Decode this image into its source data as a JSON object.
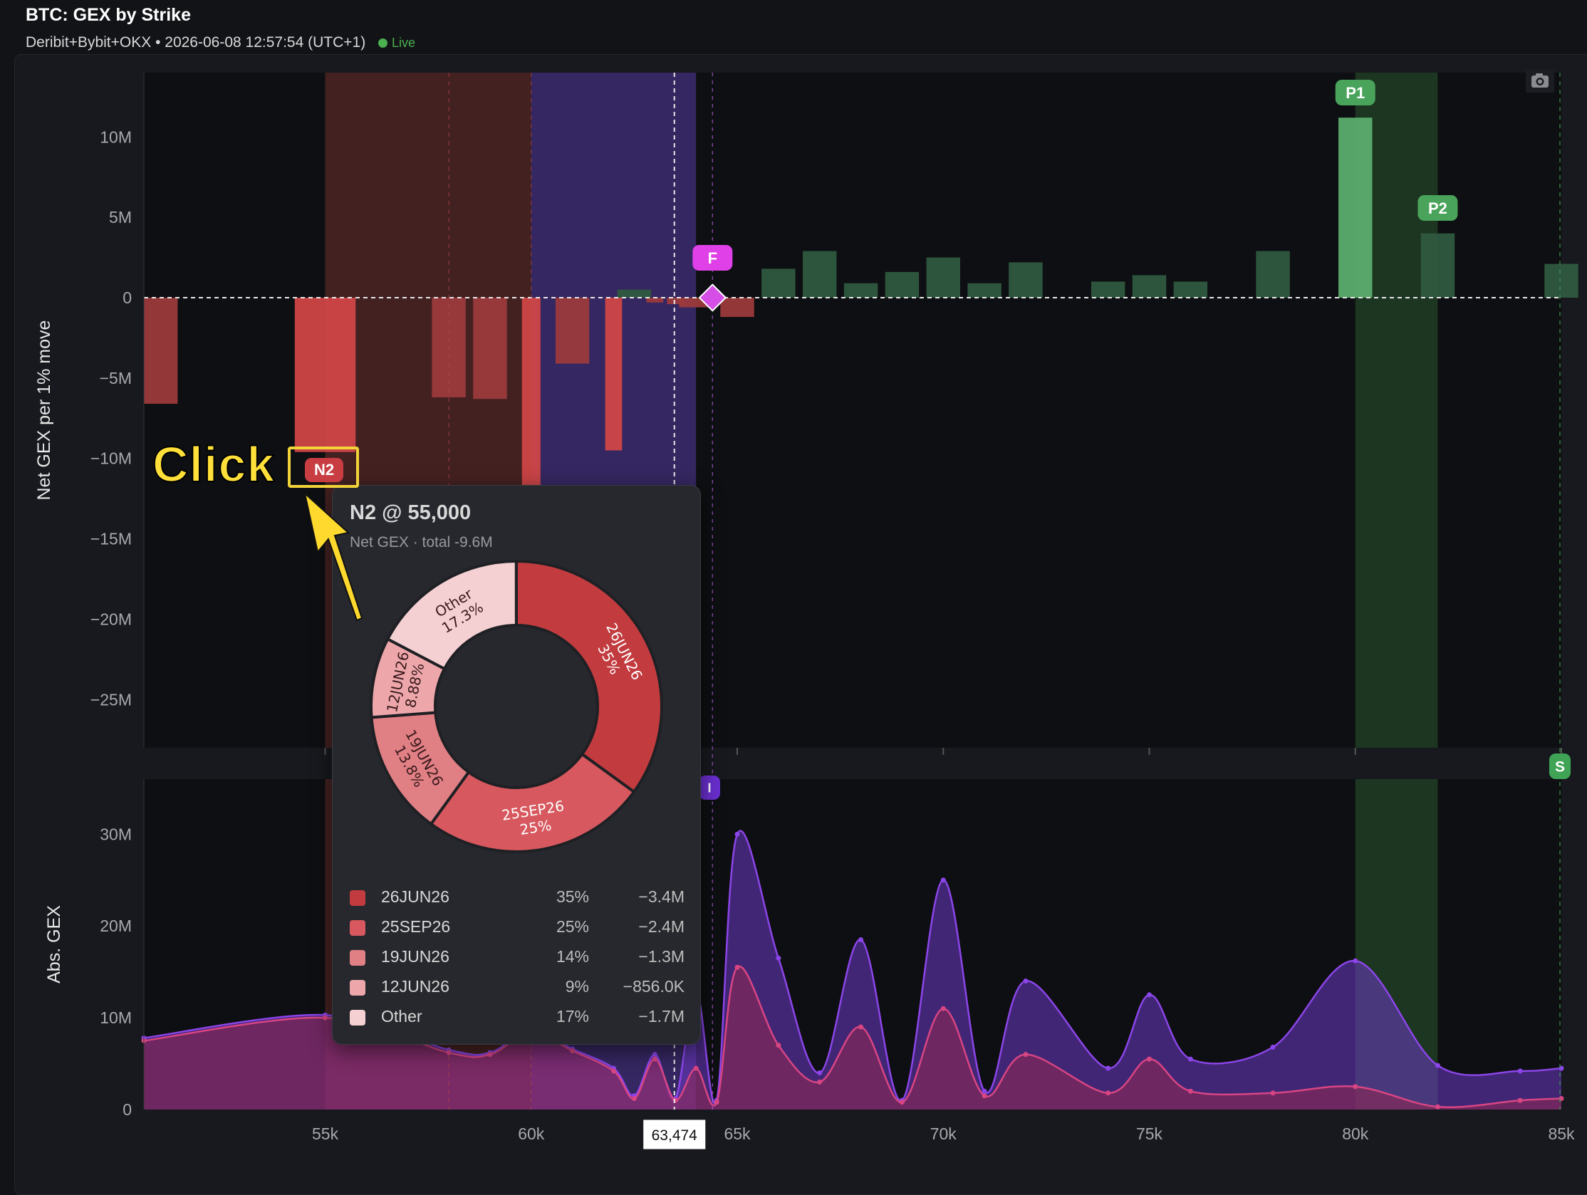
{
  "header": {
    "title": "BTC: GEX by Strike",
    "subtitle": "Deribit+Bybit+OKX • 2026-06-08 12:57:54 (UTC+1)",
    "status": "Live"
  },
  "colors": {
    "background": "#121317",
    "positive_bar": "#2f5a40",
    "positive_highlight": "#5cad6e",
    "negative_bar": "#9c3a3c",
    "negative_highlight": "#d04647",
    "purple_zone": "#3a2a6a",
    "red_zone": "#4a2424",
    "green_zone": "#1f3b24",
    "abs_total_line": "#8b45e8",
    "abs_net_line": "#d84583",
    "flip_marker": "#e040e8"
  },
  "markers": {
    "p1": "P1",
    "p2": "P2",
    "flip": "F",
    "spot": "S",
    "cursor_price": "63,474",
    "n2": "N2",
    "partial": "I"
  },
  "annotation": {
    "click": "Click"
  },
  "tooltip": {
    "title": "N2 @ 55,000",
    "subtitle": "Net GEX · total -9.6M",
    "slices": [
      {
        "name": "26JUN26",
        "pct_label": "35%",
        "legend_pct": "35%",
        "value": "−3.4M",
        "fraction": 0.35,
        "color": "#c23b3f",
        "label_color": "#ffffff"
      },
      {
        "name": "25SEP26",
        "pct_label": "25%",
        "legend_pct": "25%",
        "value": "−2.4M",
        "fraction": 0.25,
        "color": "#d7585e",
        "label_color": "#ffffff"
      },
      {
        "name": "19JUN26",
        "pct_label": "13.8%",
        "legend_pct": "14%",
        "value": "−1.3M",
        "fraction": 0.138,
        "color": "#e07f84",
        "label_color": "#3a1a1c"
      },
      {
        "name": "12JUN26",
        "pct_label": "8.88%",
        "legend_pct": "9%",
        "value": "−856.0K",
        "fraction": 0.0888,
        "color": "#eda7ab",
        "label_color": "#3a1a1c"
      },
      {
        "name": "Other",
        "pct_label": "17.3%",
        "legend_pct": "17%",
        "value": "−1.7M",
        "fraction": 0.173,
        "color": "#f5d0d2",
        "label_color": "#3a1a1c"
      }
    ]
  },
  "chart_data": [
    {
      "type": "bar",
      "ylabel": "Net GEX per 1% move",
      "xlabel": "",
      "ylim": [
        -28,
        14
      ],
      "y_ticks": [
        10,
        5,
        0,
        -5,
        -10,
        -15,
        -20,
        -25
      ],
      "y_tick_labels": [
        "10M",
        "5M",
        "0",
        "−5M",
        "−10M",
        "−15M",
        "−20M",
        "−25M"
      ],
      "y_units": "M",
      "xlim": [
        50600,
        85000
      ],
      "x_ticks": [
        55000,
        60000,
        65000,
        70000,
        75000,
        80000,
        85000
      ],
      "x_tick_labels": [
        "55k",
        "60k",
        "65k",
        "70k",
        "75k",
        "80k",
        "85k"
      ],
      "grid": false,
      "cursor_x": 63474,
      "flip_strike": 64400,
      "bars": [
        {
          "strike": 51000,
          "value": -6.6
        },
        {
          "strike": 55000,
          "value": -9.6,
          "highlight": true,
          "label": "N2"
        },
        {
          "strike": 58000,
          "value": -6.2
        },
        {
          "strike": 59000,
          "value": -6.3
        },
        {
          "strike": 60000,
          "value": -11.8,
          "highlight": true
        },
        {
          "strike": 61000,
          "value": -4.1
        },
        {
          "strike": 62000,
          "value": -9.5,
          "highlight": true
        },
        {
          "strike": 62500,
          "value": 0.5
        },
        {
          "strike": 63000,
          "value": -0.3
        },
        {
          "strike": 63500,
          "value": -0.4
        },
        {
          "strike": 64000,
          "value": -0.6
        },
        {
          "strike": 65000,
          "value": -1.2
        },
        {
          "strike": 66000,
          "value": 1.8
        },
        {
          "strike": 67000,
          "value": 2.9
        },
        {
          "strike": 68000,
          "value": 0.9
        },
        {
          "strike": 69000,
          "value": 1.6
        },
        {
          "strike": 70000,
          "value": 2.5
        },
        {
          "strike": 71000,
          "value": 0.9
        },
        {
          "strike": 72000,
          "value": 2.2
        },
        {
          "strike": 74000,
          "value": 1.0
        },
        {
          "strike": 75000,
          "value": 1.4
        },
        {
          "strike": 76000,
          "value": 1.0
        },
        {
          "strike": 78000,
          "value": 2.9
        },
        {
          "strike": 80000,
          "value": 11.2,
          "highlight": true,
          "label": "P1"
        },
        {
          "strike": 82000,
          "value": 4.0,
          "label": "P2"
        },
        {
          "strike": 85000,
          "value": 2.1
        }
      ],
      "zones": [
        {
          "from": 55000,
          "to": 60000,
          "kind": "red"
        },
        {
          "from": 60000,
          "to": 64000,
          "kind": "purple"
        },
        {
          "from": 80000,
          "to": 82000,
          "kind": "green"
        }
      ]
    },
    {
      "type": "area",
      "ylabel": "Abs. GEX",
      "xlabel": "",
      "ylim": [
        0,
        36
      ],
      "y_ticks": [
        0,
        10,
        20,
        30
      ],
      "y_tick_labels": [
        "0",
        "10M",
        "20M",
        "30M"
      ],
      "y_units": "M",
      "xlim": [
        50600,
        85000
      ],
      "x_ticks": [
        55000,
        60000,
        65000,
        70000,
        75000,
        80000,
        85000
      ],
      "x_tick_labels": [
        "55k",
        "60k",
        "65k",
        "70k",
        "75k",
        "80k",
        "85k"
      ],
      "grid": false,
      "series": [
        {
          "x": [
            50600,
            55000,
            58000,
            59000,
            60000,
            61000,
            62000,
            62500,
            63000,
            63500,
            64000,
            64500,
            65000,
            66000,
            67000,
            68000,
            69000,
            70000,
            71000,
            72000,
            74000,
            75000,
            76000,
            78000,
            80000,
            82000,
            84000,
            85000
          ],
          "y": [
            7.8,
            10.3,
            6.5,
            6.2,
            8.7,
            6.6,
            4.5,
            1.5,
            6.0,
            1.2,
            13.0,
            1.0,
            30.0,
            16.5,
            4.0,
            18.5,
            1.0,
            25.0,
            2.0,
            14.0,
            4.5,
            12.5,
            5.5,
            6.8,
            16.2,
            4.8,
            4.2,
            4.5
          ]
        },
        {
          "x": [
            50600,
            55000,
            58000,
            59000,
            60000,
            61000,
            62000,
            62500,
            63000,
            63500,
            64000,
            64500,
            65000,
            66000,
            67000,
            68000,
            69000,
            70000,
            71000,
            72000,
            74000,
            75000,
            76000,
            78000,
            80000,
            82000,
            84000,
            85000
          ],
          "y": [
            7.5,
            10.0,
            6.2,
            6.0,
            8.4,
            6.4,
            4.2,
            1.2,
            5.5,
            1.0,
            4.5,
            0.8,
            15.5,
            7.0,
            3.0,
            9.0,
            0.8,
            11.0,
            1.5,
            6.0,
            1.8,
            5.5,
            2.0,
            1.8,
            2.5,
            0.3,
            1.0,
            1.2
          ]
        }
      ],
      "zones": [
        {
          "from": 55000,
          "to": 60000,
          "kind": "red"
        },
        {
          "from": 60000,
          "to": 64000,
          "kind": "purple"
        },
        {
          "from": 80000,
          "to": 82000,
          "kind": "green"
        }
      ]
    }
  ]
}
